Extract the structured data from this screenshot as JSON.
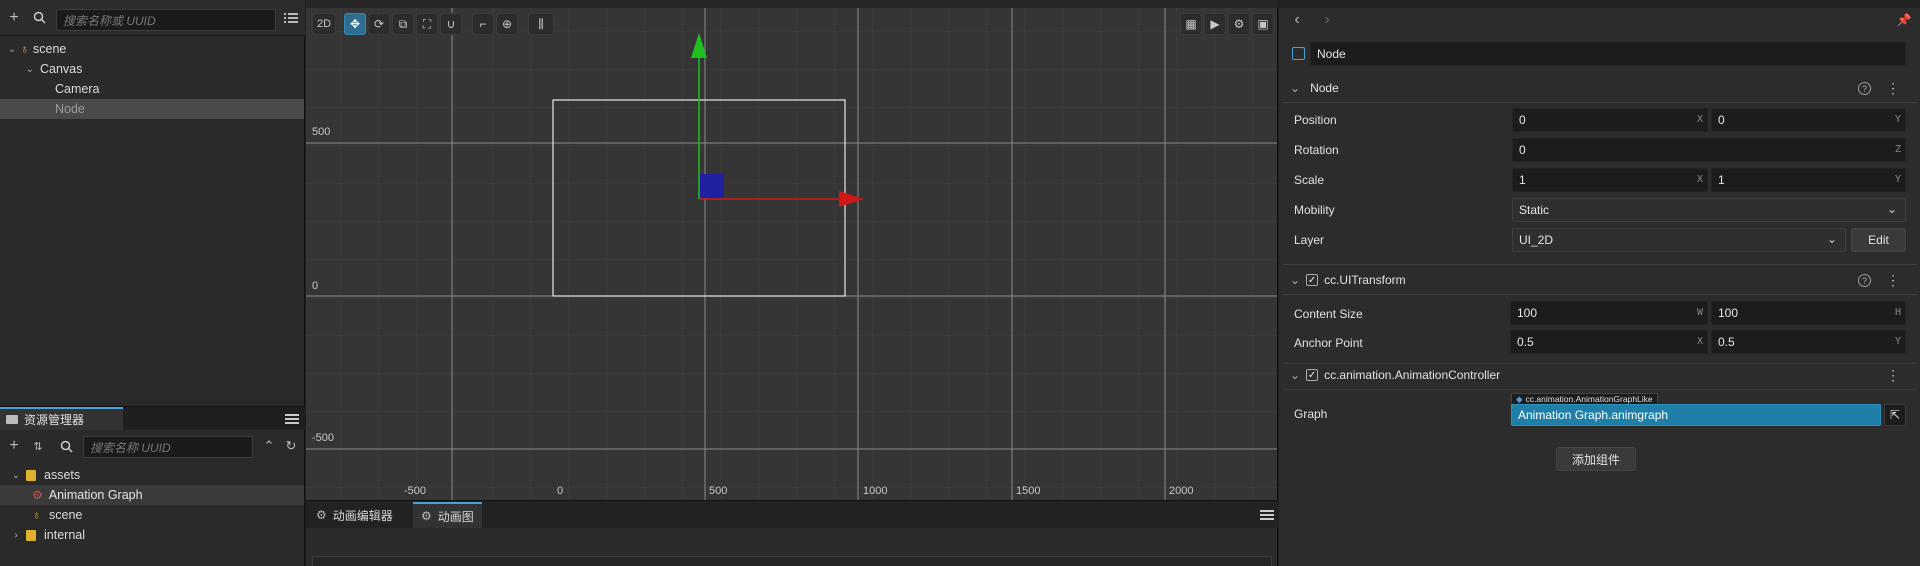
{
  "hierarchy": {
    "search_placeholder": "搜索名称或 UUID",
    "tree": [
      "scene",
      "Canvas",
      "Camera",
      "Node"
    ]
  },
  "assets": {
    "tab_label": "资源管理器",
    "search_placeholder": "搜索名称 UUID",
    "tree": [
      "assets",
      "Animation Graph",
      "scene",
      "internal"
    ]
  },
  "scene": {
    "mode_label": "2D",
    "x_labels": [
      "-500",
      "0",
      "500",
      "1000",
      "1500",
      "2000"
    ],
    "y_labels": [
      "500",
      "0",
      "-500"
    ]
  },
  "bottom": {
    "tabs": [
      "动画编辑器",
      "动画图"
    ]
  },
  "inspector": {
    "node_name": "Node",
    "node_section": {
      "title": "Node",
      "position_label": "Position",
      "position_x": "0",
      "position_y": "0",
      "rotation_label": "Rotation",
      "rotation_z": "0",
      "scale_label": "Scale",
      "scale_x": "1",
      "scale_y": "1",
      "mobility_label": "Mobility",
      "mobility_value": "Static",
      "layer_label": "Layer",
      "layer_value": "UI_2D",
      "edit_button": "Edit"
    },
    "uitransform": {
      "title": "cc.UITransform",
      "content_size_label": "Content Size",
      "width": "100",
      "height": "100",
      "anchor_label": "Anchor Point",
      "anchor_x": "0.5",
      "anchor_y": "0.5"
    },
    "anim_controller": {
      "title": "cc.animation.AnimationController",
      "graph_label": "Graph",
      "graph_type": "cc.animation.AnimationGraphLike",
      "graph_value": "Animation Graph.animgraph"
    },
    "add_component": "添加组件",
    "suffix_x": "X",
    "suffix_y": "Y",
    "suffix_z": "Z",
    "suffix_w": "W",
    "suffix_h": "H"
  }
}
